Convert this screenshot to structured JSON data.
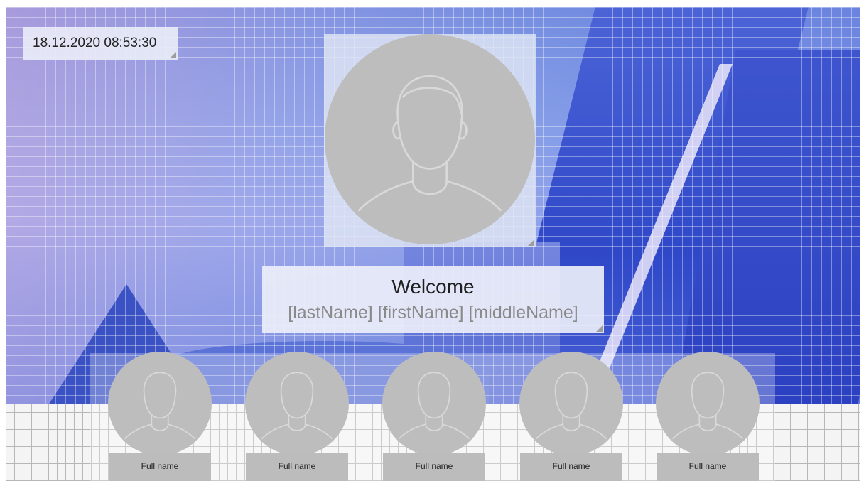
{
  "datetime": "18.12.2020 08:53:30",
  "welcome": {
    "title": "Welcome",
    "name_template": "[lastName] [firstName] [middleName]"
  },
  "main_avatar_icon": "user-silhouette-icon",
  "thumbnails": [
    {
      "label": "Full name",
      "icon": "user-silhouette-icon"
    },
    {
      "label": "Full name",
      "icon": "user-silhouette-icon"
    },
    {
      "label": "Full name",
      "icon": "user-silhouette-icon"
    },
    {
      "label": "Full name",
      "icon": "user-silhouette-icon"
    },
    {
      "label": "Full name",
      "icon": "user-silhouette-icon"
    }
  ],
  "colors": {
    "avatar_fill": "#bdbdbd",
    "avatar_outline": "#d9d9d9",
    "label_bg": "#bcbcbc",
    "background_blue": "#3b52c4"
  }
}
